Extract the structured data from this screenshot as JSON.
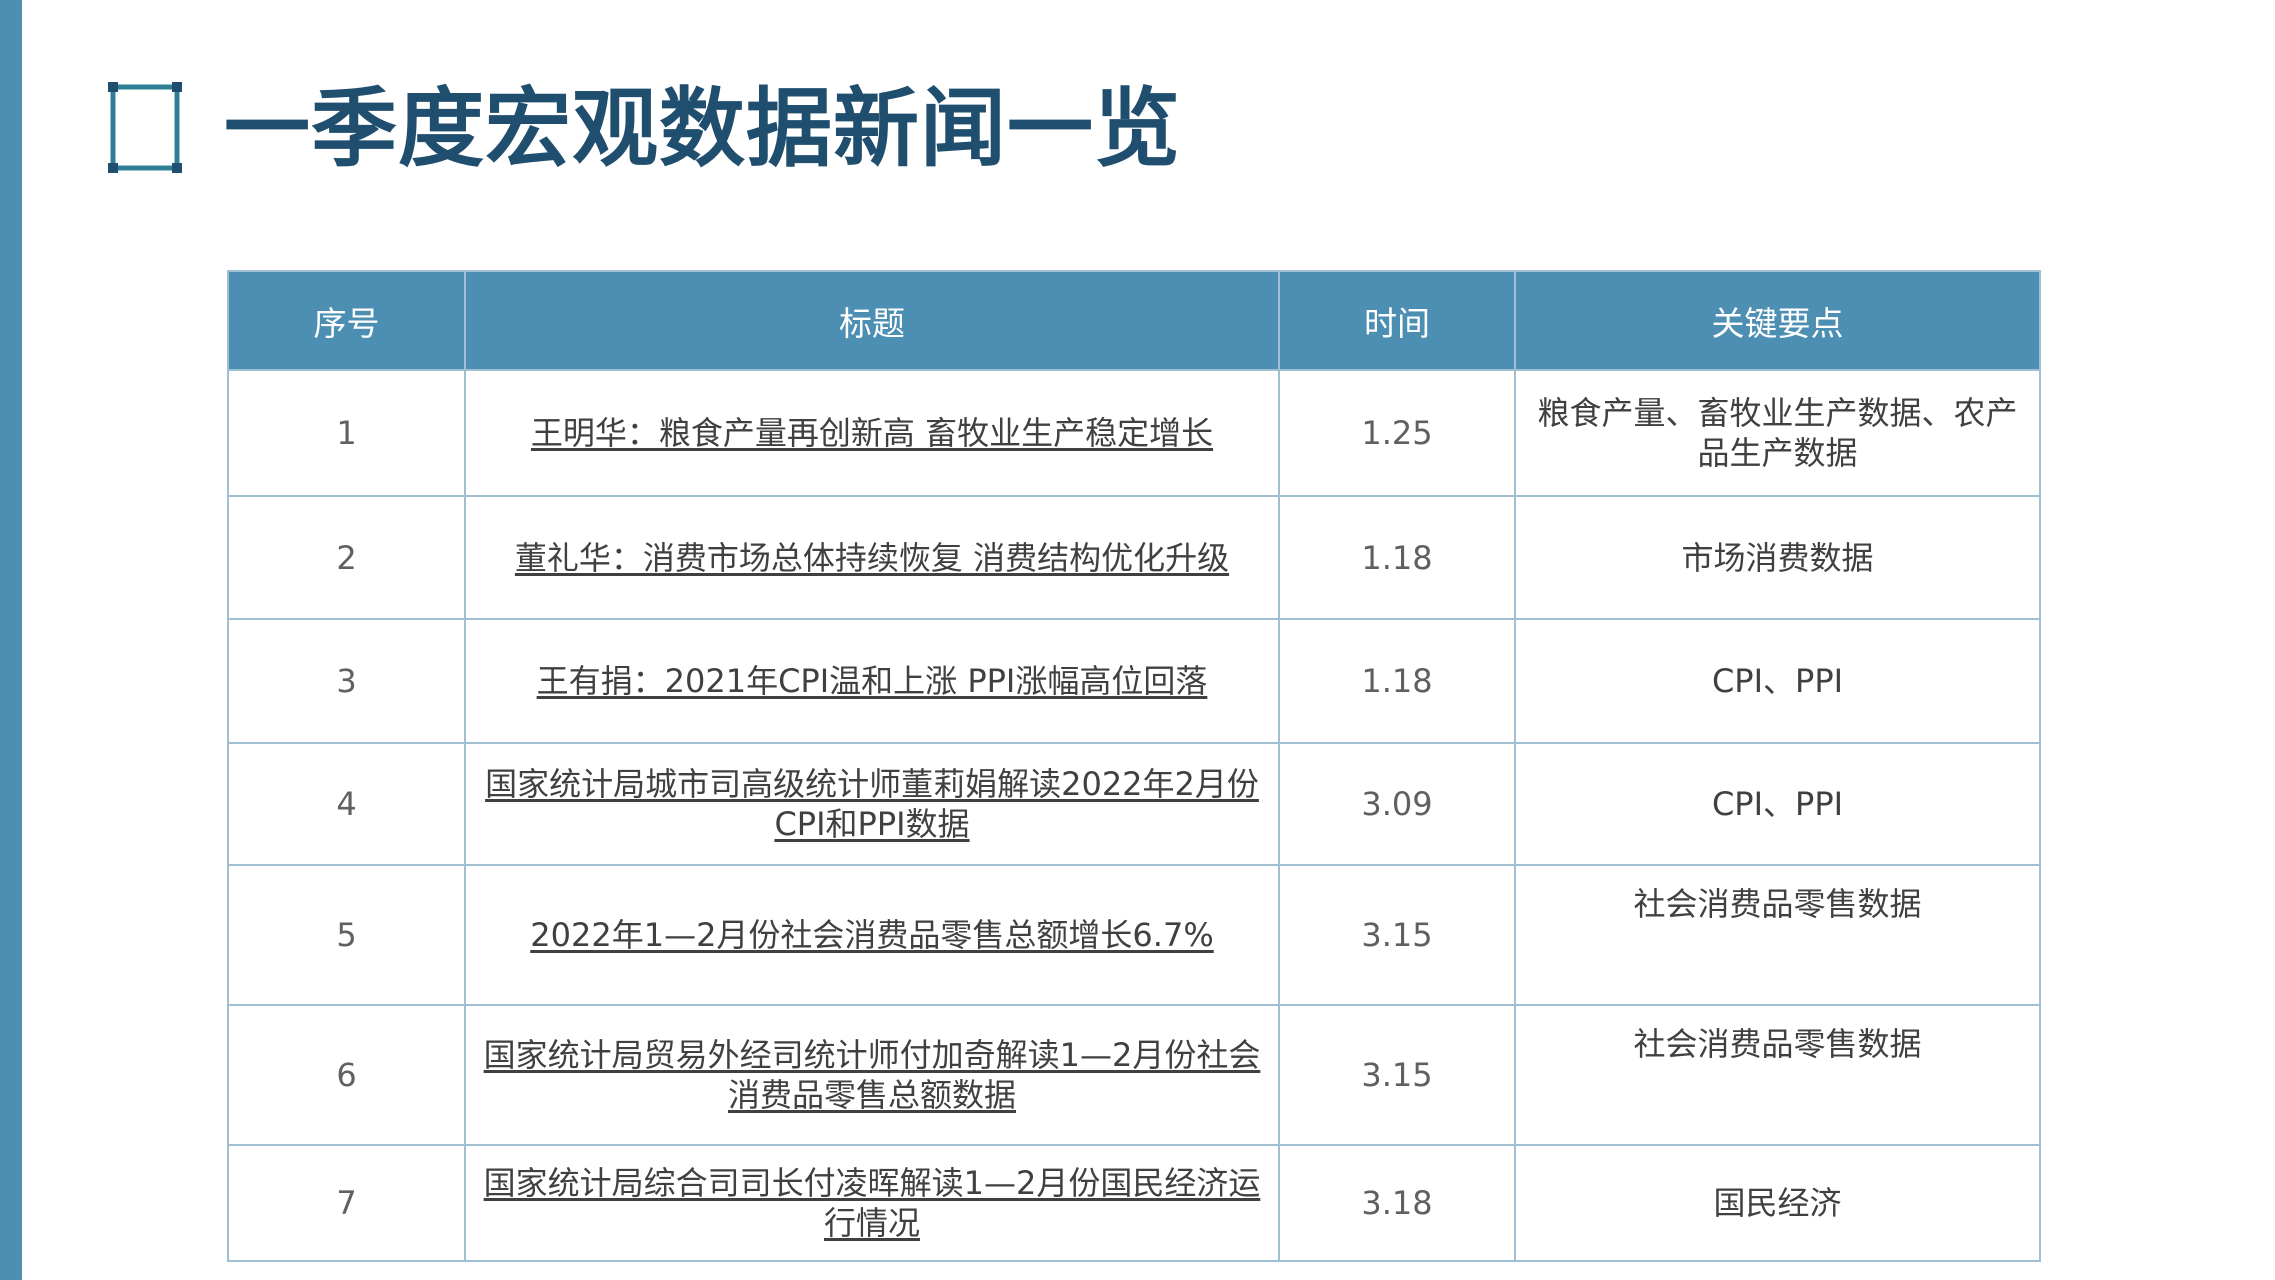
{
  "page": {
    "title": "一季度宏观数据新闻一览"
  },
  "colors": {
    "accent": "#4d8fb3",
    "title": "#1f4e6e",
    "border": "#9fc0d2"
  },
  "table": {
    "headers": [
      "序号",
      "标题",
      "时间",
      "关键要点"
    ],
    "rows": [
      {
        "num": "1",
        "title": "王明华：粮食产量再创新高 畜牧业生产稳定增长",
        "date": "1.25",
        "key": "粮食产量、畜牧业生产数据、农产品生产数据"
      },
      {
        "num": "2",
        "title": "董礼华：消费市场总体持续恢复 消费结构优化升级",
        "date": "1.18",
        "key": "市场消费数据"
      },
      {
        "num": "3",
        "title": "王有捐：2021年CPI温和上涨 PPI涨幅高位回落",
        "date": "1.18",
        "key": "CPI、PPI"
      },
      {
        "num": "4",
        "title": "国家统计局城市司高级统计师董莉娟解读2022年2月份CPI和PPI数据",
        "date": "3.09",
        "key": "CPI、PPI"
      },
      {
        "num": "5",
        "title": "2022年1—2月份社会消费品零售总额增长6.7%",
        "date": "3.15",
        "key": "社会消费品零售数据"
      },
      {
        "num": "6",
        "title": "国家统计局贸易外经司统计师付加奇解读1—2月份社会消费品零售总额数据",
        "date": "3.15",
        "key": "社会消费品零售数据"
      },
      {
        "num": "7",
        "title": "国家统计局综合司司长付凌晖解读1—2月份国民经济运行情况",
        "date": "3.18",
        "key": "国民经济"
      }
    ]
  }
}
